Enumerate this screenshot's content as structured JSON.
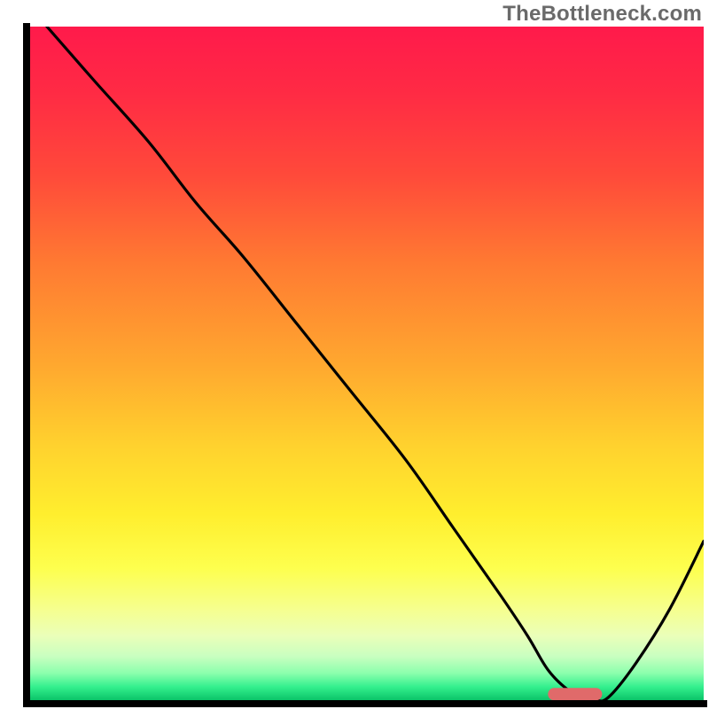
{
  "watermark": "TheBottleneck.com",
  "chart_data": {
    "type": "line",
    "title": "",
    "xlabel": "",
    "ylabel": "",
    "xlim": [
      0,
      100
    ],
    "ylim": [
      0,
      100
    ],
    "grid": false,
    "legend": false,
    "gradient_stops": [
      {
        "offset": 0.0,
        "color": "#ff1a4b"
      },
      {
        "offset": 0.1,
        "color": "#ff2b44"
      },
      {
        "offset": 0.22,
        "color": "#ff4a3a"
      },
      {
        "offset": 0.35,
        "color": "#ff7a32"
      },
      {
        "offset": 0.5,
        "color": "#ffa82f"
      },
      {
        "offset": 0.62,
        "color": "#ffd22e"
      },
      {
        "offset": 0.72,
        "color": "#ffee2e"
      },
      {
        "offset": 0.8,
        "color": "#fdff4e"
      },
      {
        "offset": 0.86,
        "color": "#f6ff8e"
      },
      {
        "offset": 0.9,
        "color": "#eaffb9"
      },
      {
        "offset": 0.93,
        "color": "#c9ffc0"
      },
      {
        "offset": 0.955,
        "color": "#8bffad"
      },
      {
        "offset": 0.975,
        "color": "#34f08e"
      },
      {
        "offset": 1.0,
        "color": "#00b85e"
      }
    ],
    "series": [
      {
        "name": "curve",
        "x": [
          3,
          10,
          18,
          25,
          32,
          40,
          48,
          56,
          63,
          70,
          74,
          77,
          80,
          82,
          84,
          86,
          90,
          95,
          100
        ],
        "y": [
          100,
          92,
          83,
          74,
          66,
          56,
          46,
          36,
          26,
          16,
          10,
          5,
          2,
          1,
          0.5,
          1,
          6,
          14,
          24
        ]
      }
    ],
    "bottom_marker": {
      "x_start": 77,
      "x_end": 85,
      "y": 1.4,
      "color": "#e06a6a"
    }
  }
}
